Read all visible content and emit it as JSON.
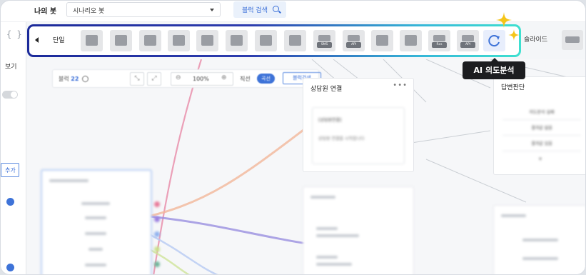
{
  "topbar": {
    "bot_label": "나의 봇",
    "scenario_value": "시나리오 봇",
    "block_search_label": "블럭 검색"
  },
  "sidebar": {
    "code_glyph": "{ }",
    "view_label": "보기",
    "add_label": "추가"
  },
  "canvas_toolbar": {
    "blocks_label": "블럭",
    "blocks_count": "22",
    "zoom_value": "100%",
    "straight_label": "직선",
    "curve_label": "곡선",
    "block_search_label": "블럭검색"
  },
  "palette": {
    "single_label": "단일",
    "slide_label": "슬라이드",
    "items": [
      {
        "icon": "text-card-icon",
        "tag": ""
      },
      {
        "icon": "image-icon",
        "tag": ""
      },
      {
        "icon": "image-card-icon",
        "tag": ""
      },
      {
        "icon": "grid-icon",
        "tag": ""
      },
      {
        "icon": "image-list-icon",
        "tag": ""
      },
      {
        "icon": "list-grid-icon",
        "tag": ""
      },
      {
        "icon": "list-icon",
        "tag": ""
      },
      {
        "icon": "web-icon",
        "tag": ""
      },
      {
        "icon": "sms-icon",
        "tag": "SMS"
      },
      {
        "icon": "location-api-icon",
        "tag": "API"
      },
      {
        "icon": "profile-card-icon",
        "tag": ""
      },
      {
        "icon": "contact-icon",
        "tag": ""
      },
      {
        "icon": "rcs-icon",
        "tag": "Rcs"
      },
      {
        "icon": "api-settings-icon",
        "tag": "API"
      }
    ],
    "ai_intent_tooltip": "AI 의도분석"
  },
  "nodes": {
    "consult": {
      "title": "상담원 연결",
      "tag_line": "[상담원연결]",
      "body_line": "상담원 연결을 시작합니다"
    },
    "answer": {
      "title": "답변판단",
      "rows": [
        "의도분석 실패",
        "결과값 없음",
        "결과값 있음"
      ]
    }
  },
  "colors": {
    "accent": "#3e73d8",
    "tooltip_bg": "#1c1d20",
    "sparkle": "#f5c518",
    "gradient_start": "#1b2a9a",
    "gradient_end": "#3ee0d0"
  }
}
